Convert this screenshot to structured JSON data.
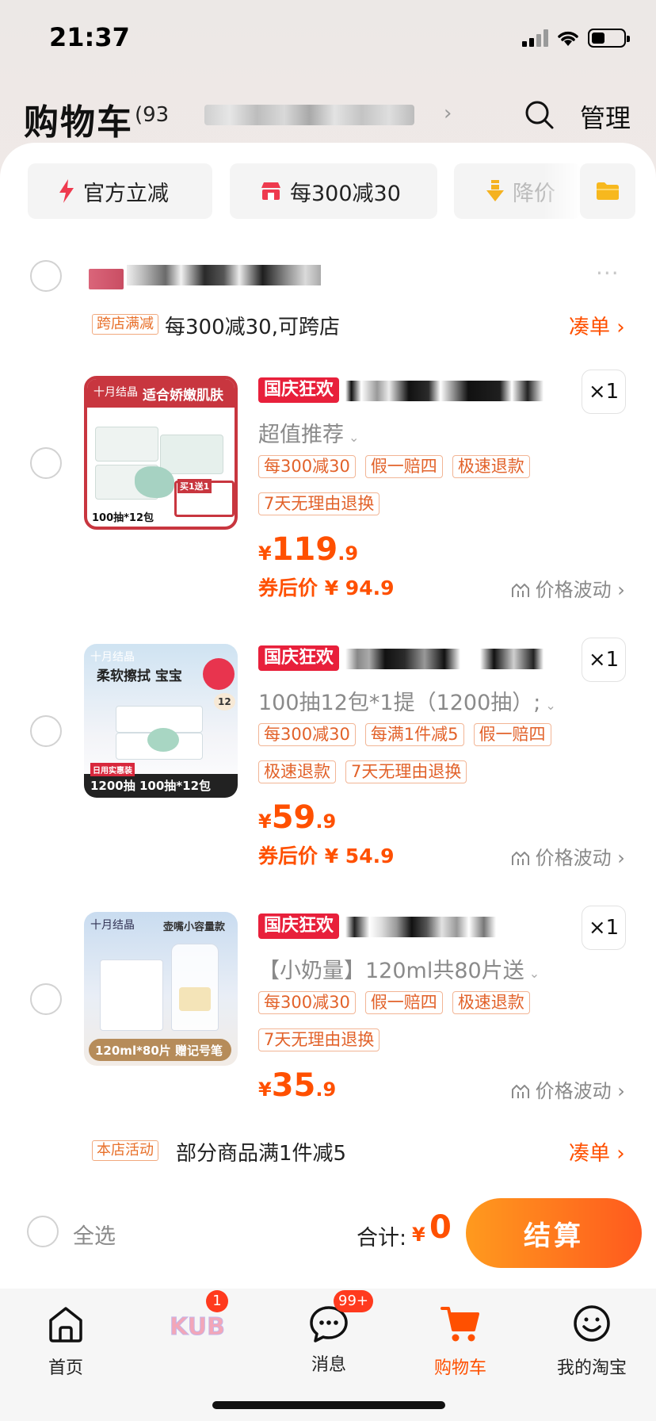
{
  "status": {
    "time": "21:37"
  },
  "header": {
    "title": "购物车",
    "count": "(93",
    "manage": "管理",
    "icons": {
      "search": "search-icon",
      "chevron": "chevron-right-icon"
    }
  },
  "filters": [
    {
      "label": "官方立减",
      "icon": "lightning-icon"
    },
    {
      "label": "每300减30",
      "icon": "store-icon"
    },
    {
      "label": "降价",
      "icon": "price-drop-icon"
    },
    {
      "label": "",
      "icon": "folder-icon"
    }
  ],
  "store": {
    "promo_tag": "跨店满减",
    "promo_text": "每300减30,可跨店",
    "gather": "凑单 ›",
    "more": "···",
    "shop_activity_tag": "本店活动",
    "shop_activity_text": "部分商品满1件减5",
    "shop_activity_gather": "凑单 ›"
  },
  "items": [
    {
      "event": "国庆狂欢",
      "qty": "×1",
      "sku": "超值推荐",
      "tags": [
        "每300减30",
        "假一赔四",
        "极速退款",
        "7天无理由退换"
      ],
      "price_currency": "¥",
      "price_int": "119",
      "price_dec": ".9",
      "coupon_price": "券后价 ¥ 94.9",
      "trend": "价格波动 ›",
      "thumb_brand": "十月结晶",
      "thumb_caption": "适合娇嫩肌肤",
      "thumb_sub": "100抽*12包",
      "thumb_badge": "买1送1"
    },
    {
      "event": "国庆狂欢",
      "qty": "×1",
      "sku": "100抽12包*1提（1200抽）;",
      "tags": [
        "每300减30",
        "每满1件减5",
        "假一赔四",
        "极速退款",
        "7天无理由退换"
      ],
      "price_currency": "¥",
      "price_int": "59",
      "price_dec": ".9",
      "coupon_price": "券后价 ¥ 54.9",
      "trend": "价格波动 ›",
      "thumb_brand": "十月结晶",
      "thumb_caption": "柔软擦拭 宝宝",
      "thumb_sub": "1200抽  100抽*12包",
      "thumb_badge": "日用实惠装",
      "thumb_num": "12"
    },
    {
      "event": "国庆狂欢",
      "qty": "×1",
      "sku": "【小奶量】120ml共80片送",
      "tags": [
        "每300减30",
        "假一赔四",
        "极速退款",
        "7天无理由退换"
      ],
      "price_currency": "¥",
      "price_int": "35",
      "price_dec": ".9",
      "coupon_price": "",
      "trend": "价格波动 ›",
      "thumb_brand": "十月结晶",
      "thumb_caption": "壶嘴小容量款",
      "thumb_sub": "120ml*80片 赠记号笔"
    }
  ],
  "settle": {
    "select_all": "全选",
    "total_label": "合计:",
    "total_currency": "¥",
    "total_value": "0",
    "checkout": "结算"
  },
  "tabs": [
    {
      "label": "首页",
      "icon": "home-icon"
    },
    {
      "label": "",
      "icon": "kub-logo-icon",
      "badge": "1"
    },
    {
      "label": "消息",
      "icon": "message-icon",
      "badge": "99+"
    },
    {
      "label": "购物车",
      "icon": "cart-icon",
      "active": true
    },
    {
      "label": "我的淘宝",
      "icon": "smile-icon"
    }
  ],
  "colors": {
    "accent": "#ff5000",
    "event_red": "#e8203b",
    "tag_border": "#f2b595"
  }
}
